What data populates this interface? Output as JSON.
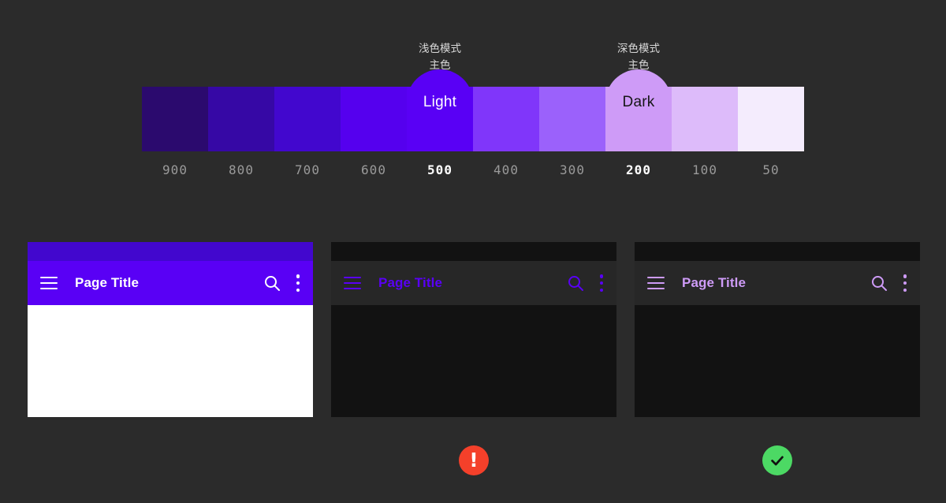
{
  "canvas": {
    "background": "#2b2b2b"
  },
  "palette": {
    "tones": [
      {
        "label": "900",
        "hex": "#2B0A6E",
        "emphasized": false
      },
      {
        "label": "800",
        "hex": "#3608A5",
        "emphasized": false
      },
      {
        "label": "700",
        "hex": "#4207CE",
        "emphasized": false
      },
      {
        "label": "600",
        "hex": "#5500EE",
        "emphasized": false
      },
      {
        "label": "500",
        "hex": "#5900F5",
        "emphasized": true
      },
      {
        "label": "400",
        "hex": "#8036FA",
        "emphasized": false
      },
      {
        "label": "300",
        "hex": "#9B61FB",
        "emphasized": false
      },
      {
        "label": "200",
        "hex": "#CE9BF7",
        "emphasized": true
      },
      {
        "label": "100",
        "hex": "#DDBBFA",
        "emphasized": false
      },
      {
        "label": "50",
        "hex": "#F4ECFD",
        "emphasized": false
      }
    ],
    "markers": [
      {
        "id": "light-primary",
        "badge_label": "Light",
        "caption_line1": "浅色模式",
        "caption_line2": "主色",
        "hex": "#5900F5",
        "text_color": "#FFFFFF",
        "tone": "500"
      },
      {
        "id": "dark-primary",
        "badge_label": "Dark",
        "caption_line1": "深色模式",
        "caption_line2": "主色",
        "hex": "#CE9BF7",
        "text_color": "#161616",
        "tone": "200"
      }
    ]
  },
  "cards": [
    {
      "id": "light-mode-appbar",
      "title": "Page Title",
      "statusbar_color": "#4207CE",
      "appbar_color": "#5900F5",
      "body_color": "#FFFFFF",
      "foreground_color": "#FFFFFF",
      "menu_icon": "hamburger-menu-icon",
      "search_icon": "search-icon",
      "overflow_icon": "more-vert-icon",
      "status": "none"
    },
    {
      "id": "dark-mode-appbar-500",
      "title": "Page Title",
      "statusbar_color": "#121212",
      "appbar_color": "#272727",
      "body_color": "#121212",
      "foreground_color": "#5900F5",
      "menu_icon": "hamburger-menu-icon",
      "search_icon": "search-icon",
      "overflow_icon": "more-vert-icon",
      "status": "error"
    },
    {
      "id": "dark-mode-appbar-200",
      "title": "Page Title",
      "statusbar_color": "#121212",
      "appbar_color": "#272727",
      "body_color": "#121212",
      "foreground_color": "#CE9BF7",
      "menu_icon": "hamburger-menu-icon",
      "search_icon": "search-icon",
      "overflow_icon": "more-vert-icon",
      "status": "success"
    }
  ],
  "badges": {
    "error": {
      "glyph": "!",
      "color": "#F4402A",
      "name": "error-badge"
    },
    "success": {
      "glyph": "✓",
      "color": "#4CD964",
      "name": "success-badge"
    }
  }
}
